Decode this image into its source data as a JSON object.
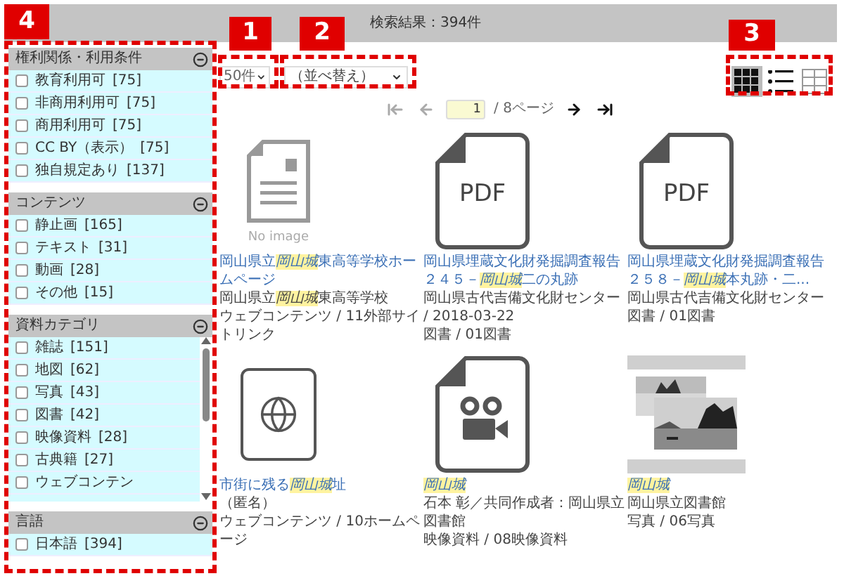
{
  "header": {
    "title": "検索結果：394件"
  },
  "annotations": [
    {
      "label": "4"
    },
    {
      "label": "1"
    },
    {
      "label": "2"
    },
    {
      "label": "3"
    }
  ],
  "sidebar": {
    "sections": [
      {
        "title": "権利関係・利用条件",
        "expanded": true,
        "kind": "plain",
        "items": [
          {
            "label": "教育利用可",
            "count": "[75]",
            "checked": false
          },
          {
            "label": "非商用利用可",
            "count": "[75]",
            "checked": false
          },
          {
            "label": "商用利用可",
            "count": "[75]",
            "checked": false
          },
          {
            "label": "CC BY（表示）",
            "count": "[75]",
            "checked": false
          },
          {
            "label": "独自規定あり",
            "count": "[137]",
            "checked": false
          }
        ]
      },
      {
        "title": "コンテンツ",
        "expanded": true,
        "kind": "plain",
        "items": [
          {
            "label": "静止画",
            "count": "[165]",
            "checked": false
          },
          {
            "label": "テキスト",
            "count": "[31]",
            "checked": false
          },
          {
            "label": "動画",
            "count": "[28]",
            "checked": false
          },
          {
            "label": "その他",
            "count": "[15]",
            "checked": false
          }
        ]
      },
      {
        "title": "資料カテゴリ",
        "expanded": true,
        "kind": "scroll",
        "items": [
          {
            "label": "雑誌",
            "count": "[151]",
            "checked": false
          },
          {
            "label": "地図",
            "count": "[62]",
            "checked": false
          },
          {
            "label": "写真",
            "count": "[43]",
            "checked": false
          },
          {
            "label": "図書",
            "count": "[42]",
            "checked": false
          },
          {
            "label": "映像資料",
            "count": "[28]",
            "checked": false
          },
          {
            "label": "古典籍",
            "count": "[27]",
            "checked": false
          },
          {
            "label": "ウェブコンテン",
            "checked": false
          }
        ]
      },
      {
        "title": "言語",
        "expanded": true,
        "kind": "plain",
        "items": [
          {
            "label": "日本語",
            "count": "[394]",
            "checked": false
          }
        ]
      }
    ]
  },
  "toolbar": {
    "per_page": "50件",
    "sort": "（並べ替え）",
    "views": [
      {
        "kind": "grid",
        "selected": true
      },
      {
        "kind": "list",
        "selected": false
      },
      {
        "kind": "table",
        "selected": false
      }
    ]
  },
  "pagination": {
    "buttons": [
      {
        "kind": "first",
        "disabled": true
      },
      {
        "kind": "prev",
        "disabled": true
      },
      {
        "kind": "next",
        "disabled": false
      },
      {
        "kind": "last",
        "disabled": false
      }
    ],
    "page": "1",
    "total": "/ 8ページ"
  },
  "cards": [
    {
      "kind": "noimage",
      "thumb_label": "No image",
      "title": [
        {
          "text": "岡山県立",
          "highlighted": false
        },
        {
          "text": "岡山城",
          "highlighted": true
        },
        {
          "text": "東高等学校ホームページ",
          "highlighted": false
        }
      ],
      "meta": [
        [
          {
            "text": "岡山県立",
            "highlighted": false
          },
          {
            "text": "岡山城",
            "highlighted": true
          },
          {
            "text": "東高等学校",
            "highlighted": false
          }
        ],
        [
          {
            "text": "ウェブコンテンツ / 11外部サイトリンク",
            "highlighted": false
          }
        ]
      ]
    },
    {
      "kind": "pdf",
      "thumb_label": "PDF",
      "title": [
        {
          "text": "岡山県埋蔵文化財発掘調査報告２４５－",
          "highlighted": false
        },
        {
          "text": "岡山城",
          "highlighted": true
        },
        {
          "text": "二の丸跡",
          "highlighted": false
        }
      ],
      "meta": [
        [
          {
            "text": "岡山県古代吉備文化財センター / 2018-03-22",
            "highlighted": false
          }
        ],
        [
          {
            "text": "図書 / 01図書",
            "highlighted": false
          }
        ]
      ]
    },
    {
      "kind": "pdf",
      "thumb_label": "PDF",
      "title": [
        {
          "text": "岡山県埋蔵文化財発掘調査報告２５８－",
          "highlighted": false
        },
        {
          "text": "岡山城",
          "highlighted": true
        },
        {
          "text": "本丸跡・二...",
          "highlighted": false
        }
      ],
      "meta": [
        [
          {
            "text": "岡山県古代吉備文化財センター",
            "highlighted": false
          }
        ],
        [
          {
            "text": "図書 / 01図書",
            "highlighted": false
          }
        ]
      ]
    },
    {
      "kind": "web",
      "title": [
        {
          "text": "市街に残る",
          "highlighted": false
        },
        {
          "text": "岡山城",
          "highlighted": true
        },
        {
          "text": "址",
          "highlighted": false
        }
      ],
      "meta": [
        [
          {
            "text": "（匿名）",
            "highlighted": false
          }
        ],
        [
          {
            "text": "ウェブコンテンツ / 10ホームページ",
            "highlighted": false
          }
        ]
      ]
    },
    {
      "kind": "video",
      "title": [
        {
          "text": "岡山城",
          "highlighted": true
        }
      ],
      "meta": [
        [
          {
            "text": "石本 彰／共同作成者：岡山県立図書館",
            "highlighted": false
          }
        ],
        [
          {
            "text": "映像資料 / 08映像資料",
            "highlighted": false
          }
        ]
      ]
    },
    {
      "title": [
        {
          "text": "岡山城",
          "highlighted": true
        }
      ],
      "meta": [
        [
          {
            "text": "岡山県立図書館",
            "highlighted": false
          }
        ],
        [
          {
            "text": "写真 / 06写真",
            "highlighted": false
          }
        ]
      ]
    }
  ]
}
